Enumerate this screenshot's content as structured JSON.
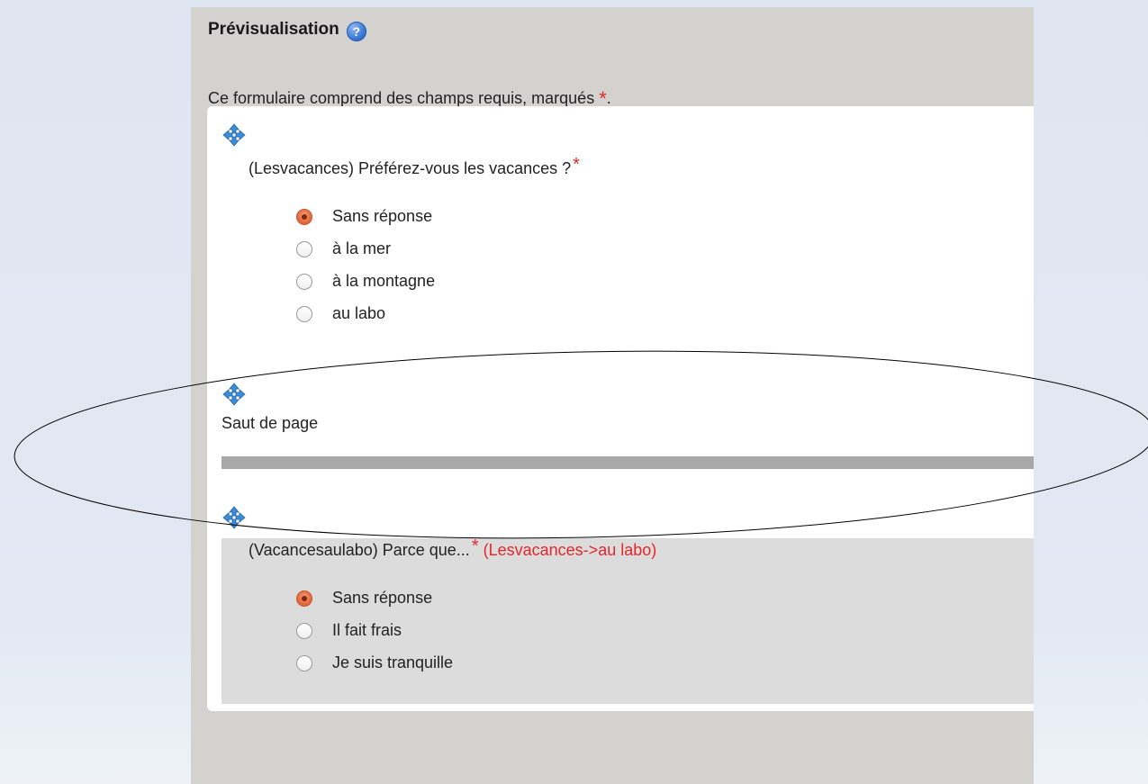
{
  "preview": {
    "title": "Prévisualisation",
    "help_icon": "?",
    "required_note": "Ce formulaire comprend des champs requis, marqués",
    "required_marker": "*",
    "required_note_end": "."
  },
  "question1": {
    "label": "(Lesvacances) Préférez-vous les vacances ?",
    "required_marker": "*",
    "options": [
      {
        "label": "Sans réponse",
        "checked": true
      },
      {
        "label": "à la mer",
        "checked": false
      },
      {
        "label": "à la montagne",
        "checked": false
      },
      {
        "label": "au labo",
        "checked": false
      }
    ]
  },
  "page_break": {
    "label": "Saut de page"
  },
  "question2": {
    "label": "(Vacancesaulabo) Parce que...",
    "required_marker": "*",
    "condition": "(Lesvacances->au labo)",
    "options": [
      {
        "label": "Sans réponse",
        "checked": true
      },
      {
        "label": "Il fait frais",
        "checked": false
      },
      {
        "label": "Je suis tranquille",
        "checked": false
      }
    ]
  },
  "colors": {
    "required": "#e5262a",
    "radio_selected": "#e56a3c",
    "panel_bg": "#d4d2cf"
  },
  "icons": {
    "move": "move-arrows-icon",
    "help": "help-icon"
  }
}
